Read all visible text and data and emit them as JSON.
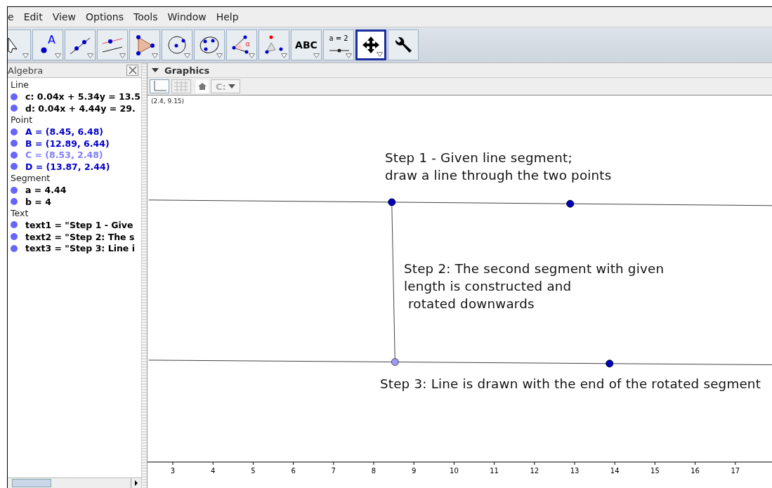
{
  "menu": [
    "e",
    "Edit",
    "View",
    "Options",
    "Tools",
    "Window",
    "Help"
  ],
  "toolbar": [
    {
      "kind": "pointer",
      "selected": false
    },
    {
      "kind": "point",
      "glyph": "A",
      "selected": false
    },
    {
      "kind": "line",
      "selected": false
    },
    {
      "kind": "parallel",
      "selected": false
    },
    {
      "kind": "polygon",
      "selected": false
    },
    {
      "kind": "circle",
      "selected": false
    },
    {
      "kind": "conic",
      "selected": false
    },
    {
      "kind": "angle",
      "glyph": "α",
      "selected": false
    },
    {
      "kind": "reflect",
      "selected": false
    },
    {
      "kind": "text",
      "glyph": "ABC",
      "selected": false
    },
    {
      "kind": "slider",
      "glyph": "a = 2",
      "selected": false
    },
    {
      "kind": "move",
      "selected": true
    },
    {
      "kind": "tools",
      "selected": false
    }
  ],
  "algebra": {
    "title": "Algebra",
    "groups": [
      {
        "name": "Line",
        "items": [
          {
            "text": "c: 0.04x + 5.34y = 13.5",
            "kind": "plain"
          },
          {
            "text": "d: 0.04x + 4.44y = 29.",
            "kind": "plain"
          }
        ]
      },
      {
        "name": "Point",
        "items": [
          {
            "text": "A = (8.45, 6.48)",
            "kind": "free"
          },
          {
            "text": "B = (12.89, 6.44)",
            "kind": "free"
          },
          {
            "text": "C = (8.53, 2.48)",
            "kind": "dependent"
          },
          {
            "text": "D = (13.87, 2.44)",
            "kind": "free"
          }
        ]
      },
      {
        "name": "Segment",
        "items": [
          {
            "text": "a = 4.44",
            "kind": "plain"
          },
          {
            "text": "b = 4",
            "kind": "plain"
          }
        ]
      },
      {
        "name": "Text",
        "items": [
          {
            "text": "text1 = \"Step 1 - Give",
            "kind": "plain"
          },
          {
            "text": "text2 = \"Step 2: The s",
            "kind": "plain"
          },
          {
            "text": "text3 = \"Step 3: Line i",
            "kind": "plain"
          }
        ]
      }
    ]
  },
  "graphics": {
    "title": "Graphics",
    "axes_on": true,
    "grid_on": false,
    "style_button": "C:",
    "coordinates": "(2.4, 9.15)",
    "texts": [
      "Step 1 - Given line segment;\ndraw a line through the two points",
      "Step 2: The second segment with given\nlength is constructed and\n rotated downwards",
      "Step 3: Line is drawn with the end of the rotated segment"
    ],
    "x_ticks": [
      "3",
      "4",
      "5",
      "6",
      "7",
      "8",
      "9",
      "10",
      "11",
      "12",
      "13",
      "14",
      "15",
      "16",
      "17"
    ]
  }
}
